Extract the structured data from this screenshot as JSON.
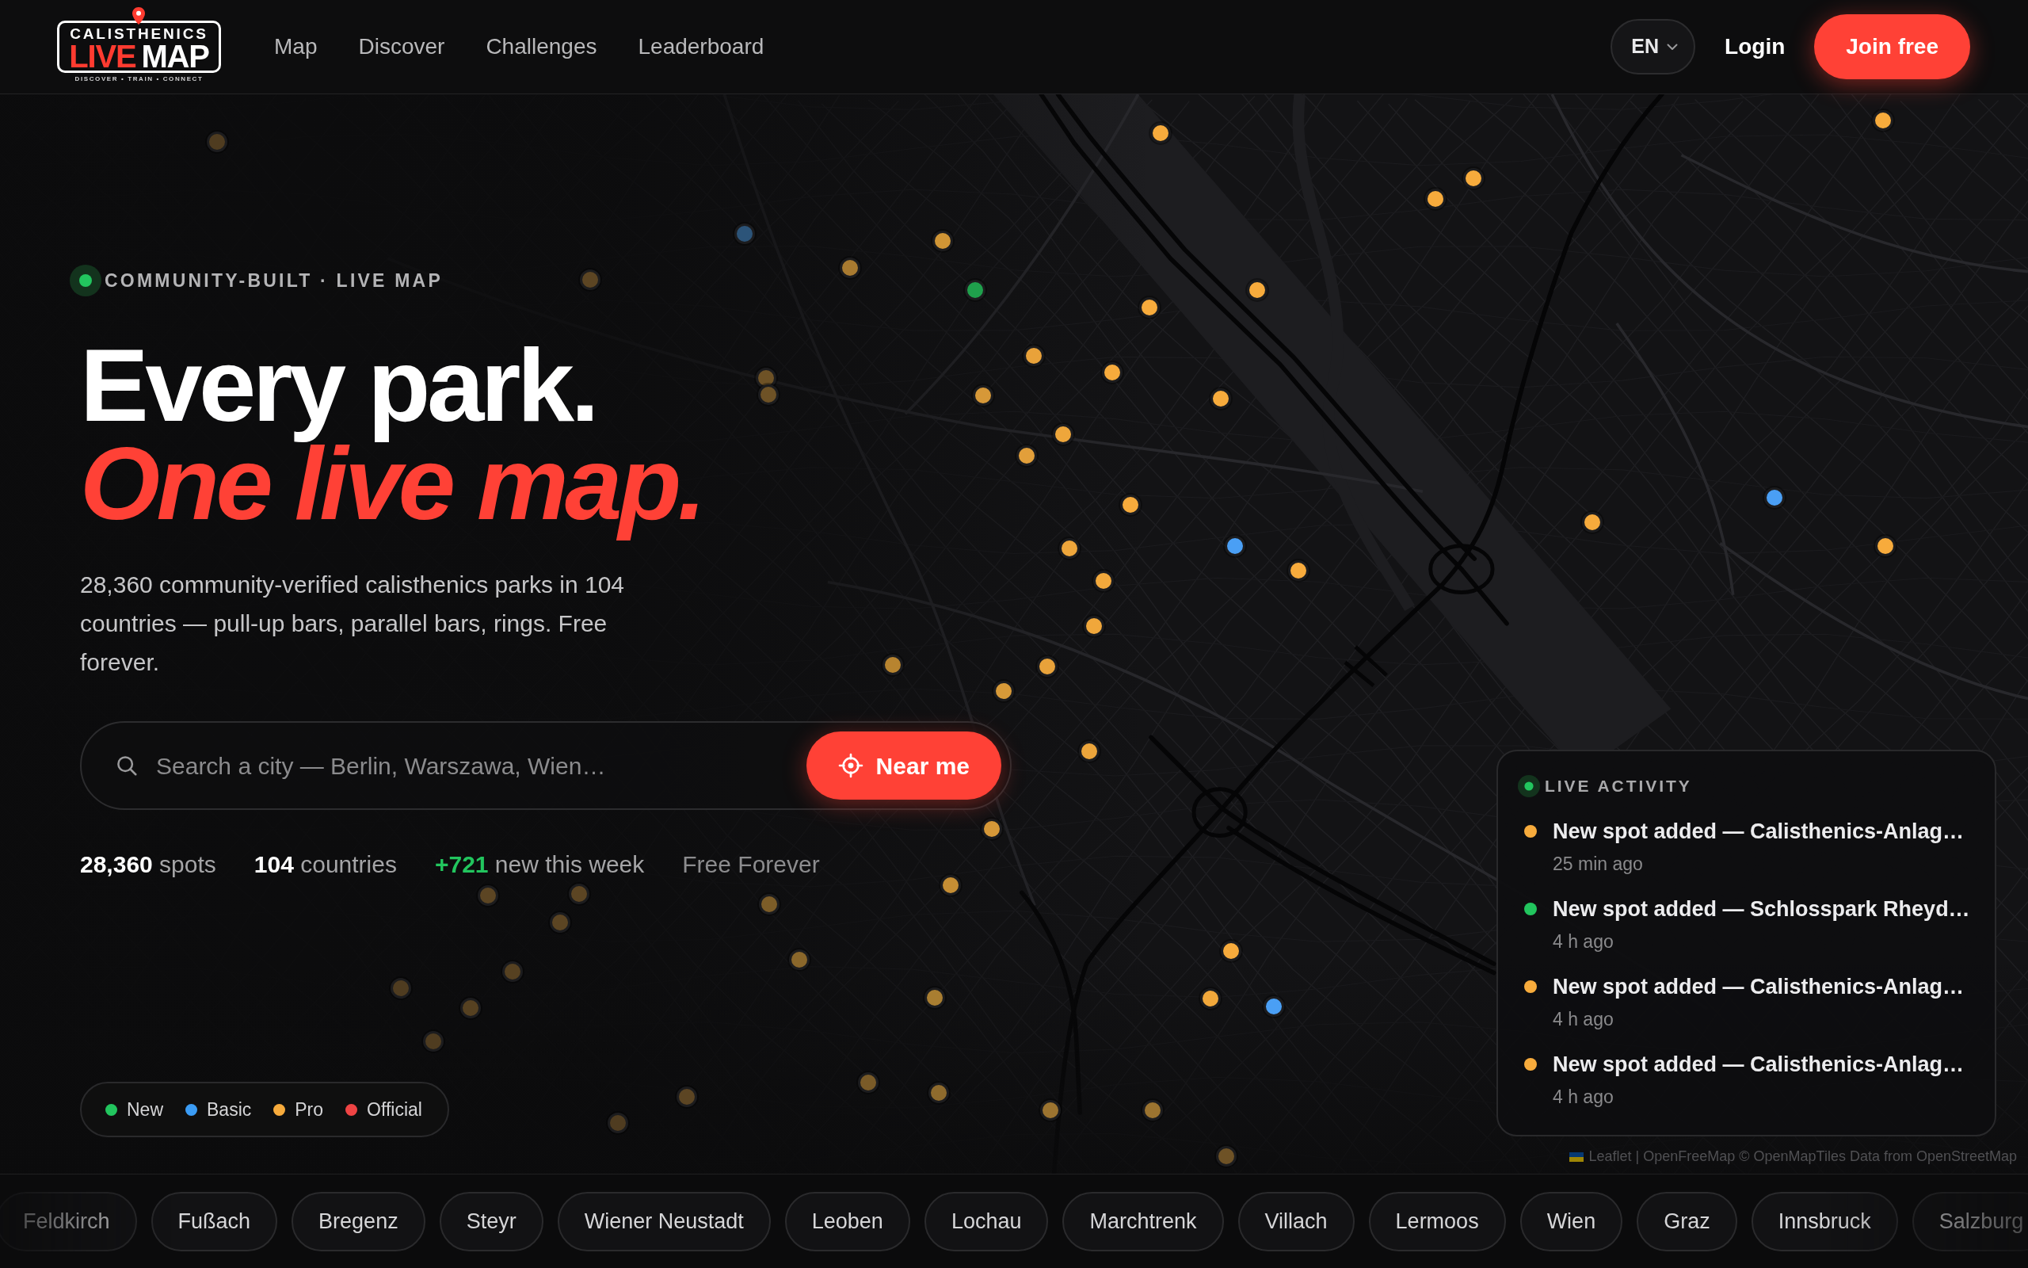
{
  "header": {
    "logo": {
      "top_text": "CALISTHENICS",
      "word_1": "LIVE",
      "word_2": "MAP",
      "tagline": "DISCOVER • TRAIN • CONNECT"
    },
    "nav": [
      {
        "label": "Map"
      },
      {
        "label": "Discover"
      },
      {
        "label": "Challenges"
      },
      {
        "label": "Leaderboard"
      }
    ],
    "language": "EN",
    "login": "Login",
    "cta": "Join free"
  },
  "hero": {
    "eyebrow": "COMMUNITY-BUILT · LIVE MAP",
    "headline": [
      {
        "text": "Every park.",
        "kind": "plain"
      },
      {
        "text": "One live map.",
        "kind": "accent"
      }
    ],
    "description": "28,360 community-verified calisthenics parks in 104 countries — pull-up bars, parallel bars, rings. Free forever.",
    "search": {
      "placeholder": "Search a city — Berlin, Warszawa, Wien…",
      "button": "Near me"
    },
    "stats": [
      {
        "kind": "count",
        "text": "**28,360** spots"
      },
      {
        "kind": "count",
        "text": "**104** countries"
      },
      {
        "kind": "growth",
        "text": "**+721** new this week"
      },
      {
        "kind": "note",
        "text": "Free Forever"
      }
    ]
  },
  "map": {
    "markers": [
      {
        "color": "#f7ab3c"
      },
      {
        "color": "#f7ab3c"
      },
      {
        "color": "#f7ab3c"
      },
      {
        "color": "#f7ab3c"
      },
      {
        "color": "#2c5479"
      },
      {
        "color": "#d09535"
      },
      {
        "color": "#a87a30"
      },
      {
        "color": "#1fa04c"
      },
      {
        "color": "#f7ab3c"
      },
      {
        "color": "#f7ab3c"
      },
      {
        "color": "#e9a23a"
      },
      {
        "color": "#f7ab3c"
      },
      {
        "color": "#d69838"
      },
      {
        "color": "#f7ab3c"
      },
      {
        "color": "#eea63b"
      },
      {
        "color": "#e29f3a"
      },
      {
        "color": "#f7ab3c"
      },
      {
        "color": "#4a9ff5"
      },
      {
        "color": "#f7ab3c"
      },
      {
        "color": "#f7ab3c"
      },
      {
        "color": "#4a9ff5"
      },
      {
        "color": "#f7ab3c"
      },
      {
        "color": "#eea63b"
      },
      {
        "color": "#f3a93c"
      },
      {
        "color": "#f0a73b"
      },
      {
        "color": "#e8a23a"
      },
      {
        "color": "#b8842f"
      },
      {
        "color": "#d89a38"
      },
      {
        "color": "#eca53b"
      },
      {
        "color": "#d69838"
      },
      {
        "color": "#c68e34"
      },
      {
        "color": "#7d5d28"
      },
      {
        "color": "#8a672b"
      },
      {
        "color": "#a97e31"
      },
      {
        "color": "#f7ab3c"
      },
      {
        "color": "#f2a83b"
      },
      {
        "color": "#4a9ff5"
      },
      {
        "color": "#7a5b28"
      },
      {
        "color": "#8f6b2d"
      },
      {
        "color": "#9c7430"
      },
      {
        "color": "#9c7430"
      },
      {
        "color": "#6e5226"
      },
      {
        "color": "#5c4523"
      },
      {
        "color": "#4f3c20"
      },
      {
        "color": "#4f3c20"
      },
      {
        "color": "#5c4523"
      },
      {
        "color": "#6e5226"
      },
      {
        "color": "#6e5226"
      },
      {
        "color": "#5c4523"
      },
      {
        "color": "#5c4523"
      },
      {
        "color": "#5c4523"
      },
      {
        "color": "#564121"
      },
      {
        "color": "#4f3c20"
      },
      {
        "color": "#564121"
      },
      {
        "color": "#4f3c20"
      }
    ],
    "legend": [
      {
        "label": "New",
        "color": "#22c55e"
      },
      {
        "label": "Basic",
        "color": "#3b9cf5"
      },
      {
        "label": "Pro",
        "color": "#f7ab3c"
      },
      {
        "label": "Official",
        "color": "#ef4444"
      }
    ],
    "attribution": "Leaflet | OpenFreeMap © OpenMapTiles Data from OpenStreetMap"
  },
  "live_activity": {
    "title": "LIVE ACTIVITY",
    "items": [
      {
        "text": "New spot added — Calisthenics-Anlag…",
        "time": "25 min ago",
        "color": "#f7ab3c"
      },
      {
        "text": "New spot added — Schlosspark Rheyd…",
        "time": "4 h ago",
        "color": "#22c55e"
      },
      {
        "text": "New spot added — Calisthenics-Anlag…",
        "time": "4 h ago",
        "color": "#f7ab3c"
      },
      {
        "text": "New spot added — Calisthenics-Anlag…",
        "time": "4 h ago",
        "color": "#f7ab3c"
      }
    ]
  },
  "cities": [
    {
      "label": "Feldkirch"
    },
    {
      "label": "Fußach"
    },
    {
      "label": "Bregenz"
    },
    {
      "label": "Steyr"
    },
    {
      "label": "Wiener Neustadt"
    },
    {
      "label": "Leoben"
    },
    {
      "label": "Lochau"
    },
    {
      "label": "Marchtrenk"
    },
    {
      "label": "Villach"
    },
    {
      "label": "Lermoos"
    },
    {
      "label": "Wien"
    },
    {
      "label": "Graz"
    },
    {
      "label": "Innsbruck"
    },
    {
      "label": "Salzburg"
    }
  ]
}
